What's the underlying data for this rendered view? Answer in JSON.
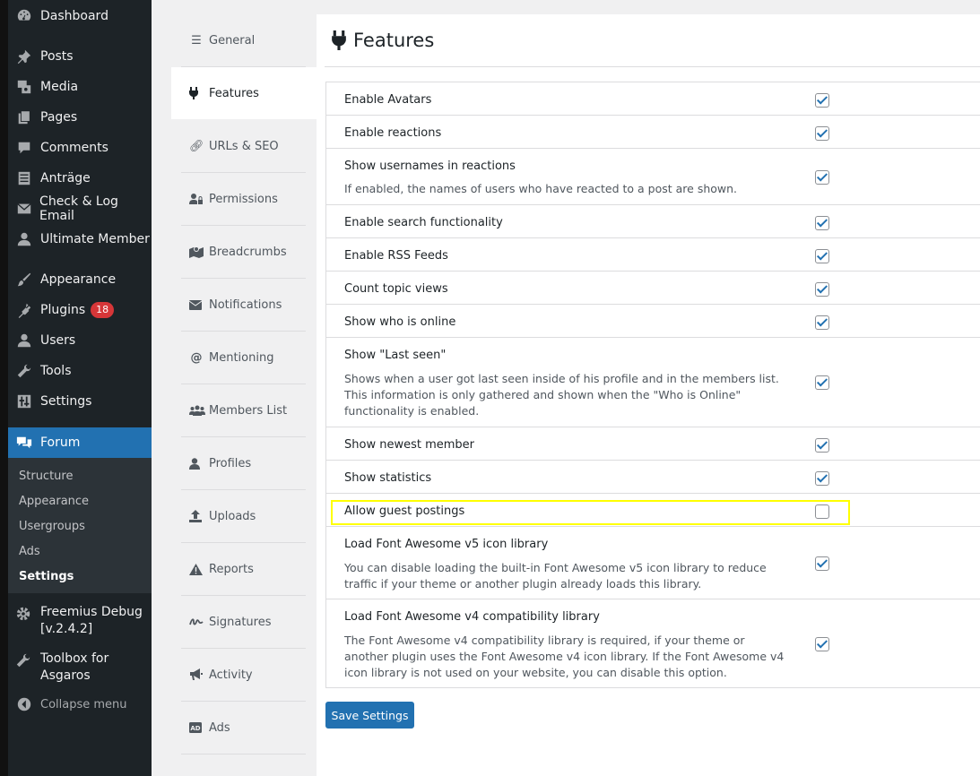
{
  "admin_menu": {
    "items": [
      {
        "label": "Dashboard",
        "icon": "dashboard-icon"
      },
      {
        "label": "Posts",
        "icon": "pin-icon"
      },
      {
        "label": "Media",
        "icon": "media-icon"
      },
      {
        "label": "Pages",
        "icon": "pages-icon"
      },
      {
        "label": "Comments",
        "icon": "comments-icon"
      },
      {
        "label": "Anträge",
        "icon": "document-icon"
      },
      {
        "label": "Check & Log Email",
        "icon": "email-icon"
      },
      {
        "label": "Ultimate Member",
        "icon": "user-icon"
      },
      {
        "label": "Appearance",
        "icon": "brush-icon"
      },
      {
        "label": "Plugins",
        "icon": "plugin-icon",
        "badge": "18"
      },
      {
        "label": "Users",
        "icon": "users-icon"
      },
      {
        "label": "Tools",
        "icon": "wrench-icon"
      },
      {
        "label": "Settings",
        "icon": "settings-icon"
      },
      {
        "label": "Forum",
        "icon": "forum-icon"
      }
    ],
    "forum_submenu": [
      "Structure",
      "Appearance",
      "Usergroups",
      "Ads",
      "Settings"
    ],
    "freemius": "Freemius Debug [v.2.4.2]",
    "freemius_line1": "Freemius Debug",
    "freemius_line2": "[v.2.4.2]",
    "toolbox_line1": "Toolbox for",
    "toolbox_line2": "Asgaros",
    "collapse": "Collapse menu"
  },
  "tabs": [
    {
      "label": "General",
      "icon": "sliders-icon"
    },
    {
      "label": "Features",
      "icon": "plug-icon"
    },
    {
      "label": "URLs & SEO",
      "icon": "link-icon"
    },
    {
      "label": "Permissions",
      "icon": "user-lock-icon"
    },
    {
      "label": "Breadcrumbs",
      "icon": "map-icon"
    },
    {
      "label": "Notifications",
      "icon": "envelope-icon"
    },
    {
      "label": "Mentioning",
      "icon": "at-icon"
    },
    {
      "label": "Members List",
      "icon": "users-icon"
    },
    {
      "label": "Profiles",
      "icon": "user-icon"
    },
    {
      "label": "Uploads",
      "icon": "upload-icon"
    },
    {
      "label": "Reports",
      "icon": "warning-icon"
    },
    {
      "label": "Signatures",
      "icon": "signature-icon"
    },
    {
      "label": "Activity",
      "icon": "bullhorn-icon"
    },
    {
      "label": "Ads",
      "icon": "ad-icon"
    }
  ],
  "page": {
    "title": "Features",
    "title_icon": "plug-icon"
  },
  "settings": [
    {
      "label": "Enable Avatars",
      "checked": true
    },
    {
      "label": "Enable reactions",
      "checked": true
    },
    {
      "label": "Show usernames in reactions",
      "desc": "If enabled, the names of users who have reacted to a post are shown.",
      "checked": true
    },
    {
      "label": "Enable search functionality",
      "checked": true
    },
    {
      "label": "Enable RSS Feeds",
      "checked": true
    },
    {
      "label": "Count topic views",
      "checked": true
    },
    {
      "label": "Show who is online",
      "checked": true
    },
    {
      "label": "Show \"Last seen\"",
      "desc": "Shows when a user got last seen inside of his profile and in the members list. This information is only gathered and shown when the \"Who is Online\" functionality is enabled.",
      "checked": true
    },
    {
      "label": "Show newest member",
      "checked": true
    },
    {
      "label": "Show statistics",
      "checked": true
    },
    {
      "label": "Allow guest postings",
      "checked": false
    },
    {
      "label": "Load Font Awesome v5 icon library",
      "desc": "You can disable loading the built-in Font Awesome v5 icon library to reduce traffic if your theme or another plugin already loads this library.",
      "checked": true
    },
    {
      "label": "Load Font Awesome v4 compatibility library",
      "desc": "The Font Awesome v4 compatibility library is required, if your theme or another plugin uses the Font Awesome v4 icon library. If the Font Awesome v4 icon library is not used on your website, you can disable this option.",
      "checked": true
    }
  ],
  "save_button": "Save Settings",
  "colors": {
    "accent": "#2271b1",
    "menu_bg": "#1d2327",
    "highlight": "#ffff00",
    "badge": "#d63638"
  }
}
